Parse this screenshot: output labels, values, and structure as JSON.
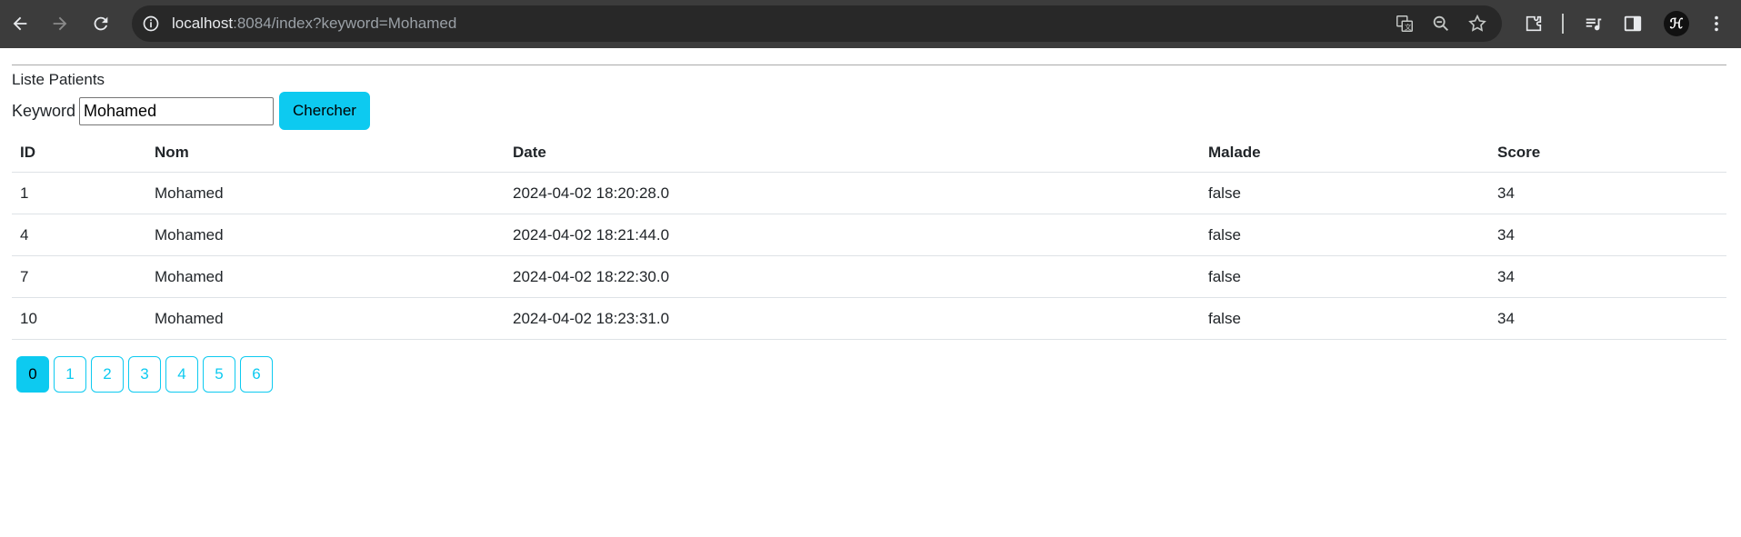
{
  "browser": {
    "url_host": "localhost",
    "url_rest": ":8084/index?keyword=Mohamed"
  },
  "page": {
    "heading": "Liste Patients",
    "search": {
      "label": "Keyword",
      "value": "Mohamed",
      "button": "Chercher"
    },
    "table": {
      "headers": {
        "id": "ID",
        "nom": "Nom",
        "date": "Date",
        "malade": "Malade",
        "score": "Score"
      },
      "rows": [
        {
          "id": "1",
          "nom": "Mohamed",
          "date": "2024-04-02 18:20:28.0",
          "malade": "false",
          "score": "34"
        },
        {
          "id": "4",
          "nom": "Mohamed",
          "date": "2024-04-02 18:21:44.0",
          "malade": "false",
          "score": "34"
        },
        {
          "id": "7",
          "nom": "Mohamed",
          "date": "2024-04-02 18:22:30.0",
          "malade": "false",
          "score": "34"
        },
        {
          "id": "10",
          "nom": "Mohamed",
          "date": "2024-04-02 18:23:31.0",
          "malade": "false",
          "score": "34"
        }
      ]
    },
    "pagination": [
      "0",
      "1",
      "2",
      "3",
      "4",
      "5",
      "6"
    ],
    "active_page": "0"
  },
  "colors": {
    "accent": "#0dcaf0",
    "toolbar": "#3c3c3c",
    "omnibox": "#282828"
  }
}
